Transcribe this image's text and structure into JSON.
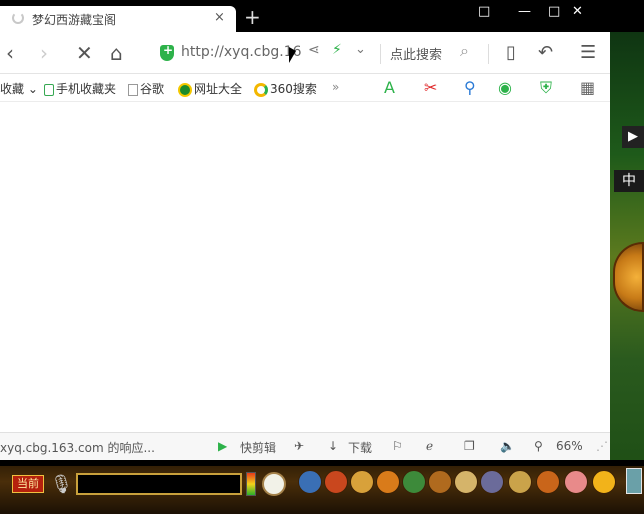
{
  "tab": {
    "title": "梦幻西游藏宝阁",
    "close": "×",
    "new_tab": "+"
  },
  "window_controls": {
    "restore": "⧉",
    "minimize": "—",
    "maximize": "□",
    "close": "✕"
  },
  "toolbar": {
    "back": "‹",
    "forward": "›",
    "stop": "✕",
    "home": "⌂",
    "url": "http://xyq.cbg.16",
    "share": "⋖",
    "bolt": "⚡",
    "dropdown": "⌄",
    "search_label": "点此搜索",
    "search_icon": "⌕",
    "device": "▯",
    "undo": "↶",
    "menu": "☰"
  },
  "bookmarks": {
    "items": [
      {
        "label": "收藏"
      },
      {
        "label": "手机收藏夹"
      },
      {
        "label": "谷歌"
      },
      {
        "label": "网址大全"
      },
      {
        "label": "360搜索"
      }
    ],
    "more": "»"
  },
  "statusbar": {
    "status_text": "xyq.cbg.163.com 的响应...",
    "clip_label": "快剪辑",
    "download_label": "下载",
    "zoom": "66%"
  },
  "game": {
    "middle_text": "中",
    "play": "▶",
    "channel": "当前"
  },
  "colors": {
    "accent_green": "#2db24a",
    "game_gold": "#c9a13c",
    "channel_red": "#b5210d"
  }
}
